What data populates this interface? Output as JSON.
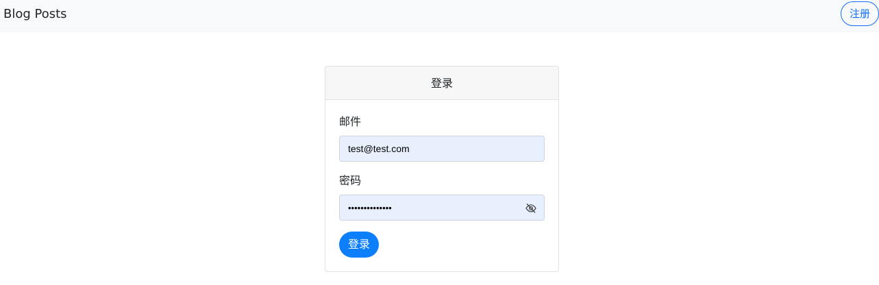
{
  "navbar": {
    "brand": "Blog Posts",
    "register_label": "注册"
  },
  "login_card": {
    "title": "登录",
    "email_label": "邮件",
    "email_value": "test@test.com",
    "password_label": "密码",
    "password_value": "••••••••••••••",
    "password_toggle_icon": "eye-slash-icon",
    "submit_label": "登录"
  },
  "colors": {
    "primary": "#0d6efd",
    "autofill_bg": "#e8f0fe",
    "navbar_bg": "#f8f9fa",
    "card_header_bg": "#f7f7f7"
  }
}
